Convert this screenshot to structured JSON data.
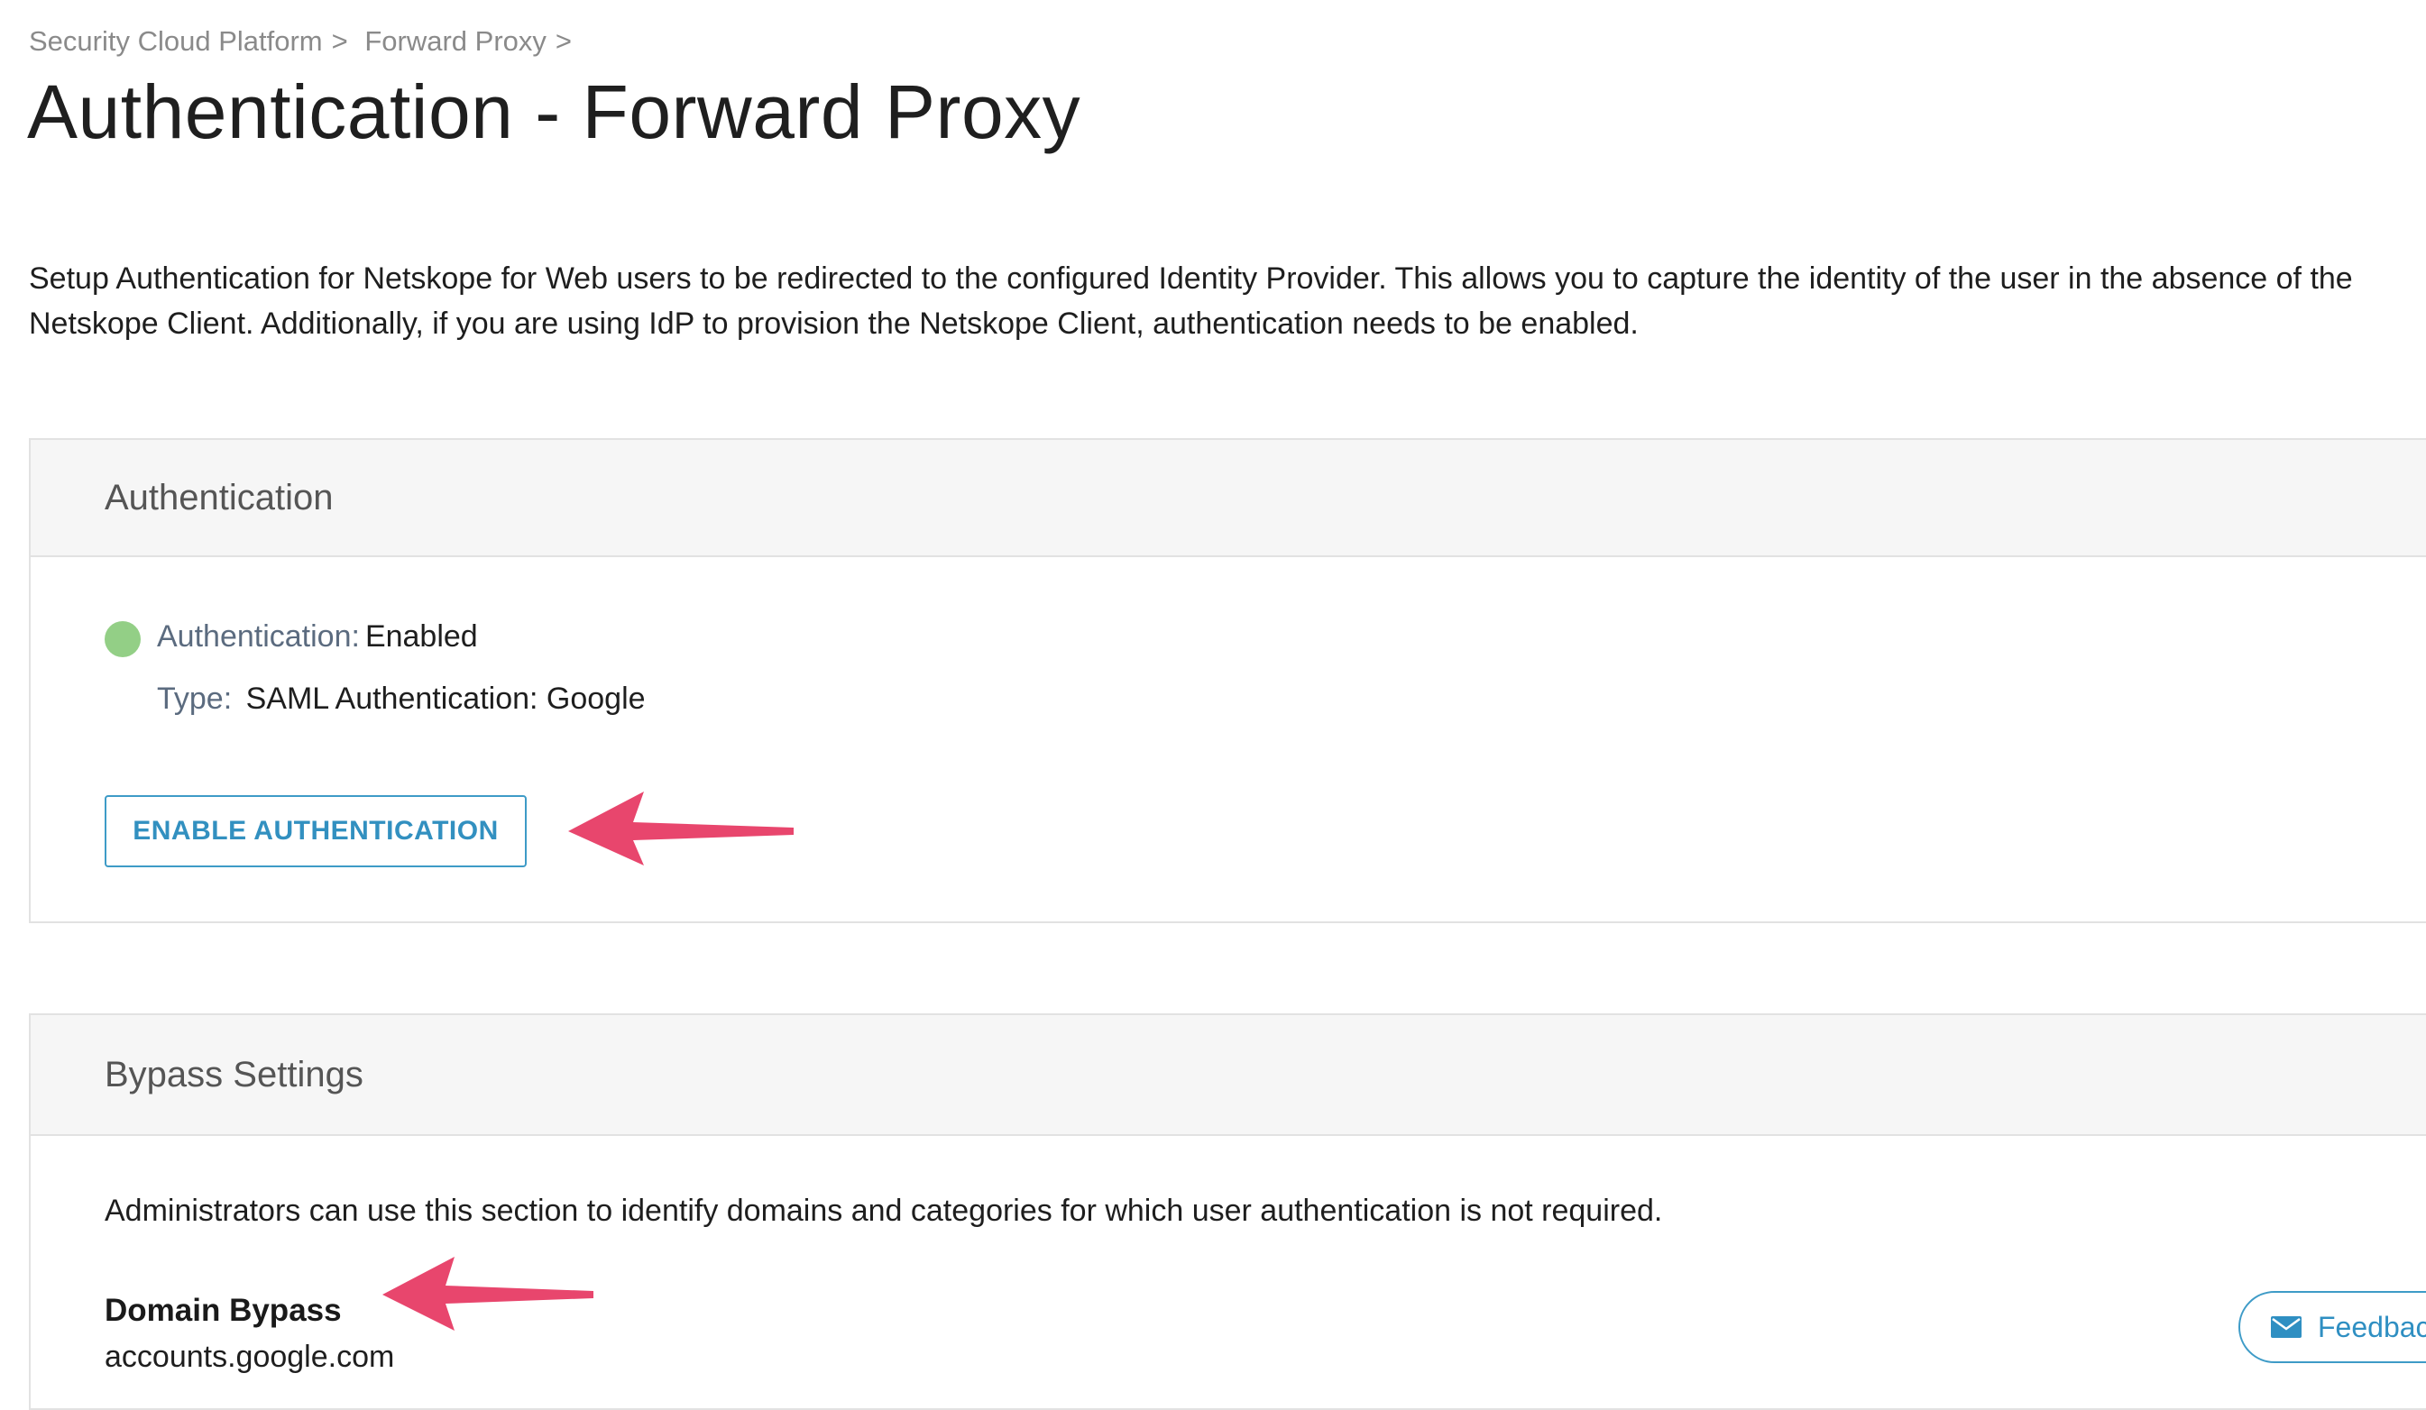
{
  "breadcrumb": {
    "items": [
      "Security Cloud Platform",
      "Forward Proxy"
    ],
    "separator": ">"
  },
  "page": {
    "title": "Authentication - Forward Proxy",
    "intro": "Setup Authentication for Netskope for Web users to be redirected to the configured Identity Provider. This allows you to capture the identity of the user in the absence of the Netskope Client. Additionally, if you are using IdP to provision the Netskope Client, authentication needs to be enabled."
  },
  "auth_panel": {
    "header": "Authentication",
    "status_label": "Authentication:",
    "status_value": "Enabled",
    "status_color": "#93cf86",
    "type_label": "Type:",
    "type_value": "SAML Authentication: Google",
    "enable_button": "ENABLE AUTHENTICATION"
  },
  "bypass_panel": {
    "header": "Bypass Settings",
    "description": "Administrators can use this section to identify domains and categories for which user authentication is not required.",
    "domain_title": "Domain Bypass",
    "domain_value": "accounts.google.com"
  },
  "feedback": {
    "label": "Feedback",
    "icon": "envelope-icon"
  },
  "colors": {
    "accent": "#3e9bc7",
    "arrow": "#e8466d",
    "panel_header_bg": "#f6f6f6"
  }
}
